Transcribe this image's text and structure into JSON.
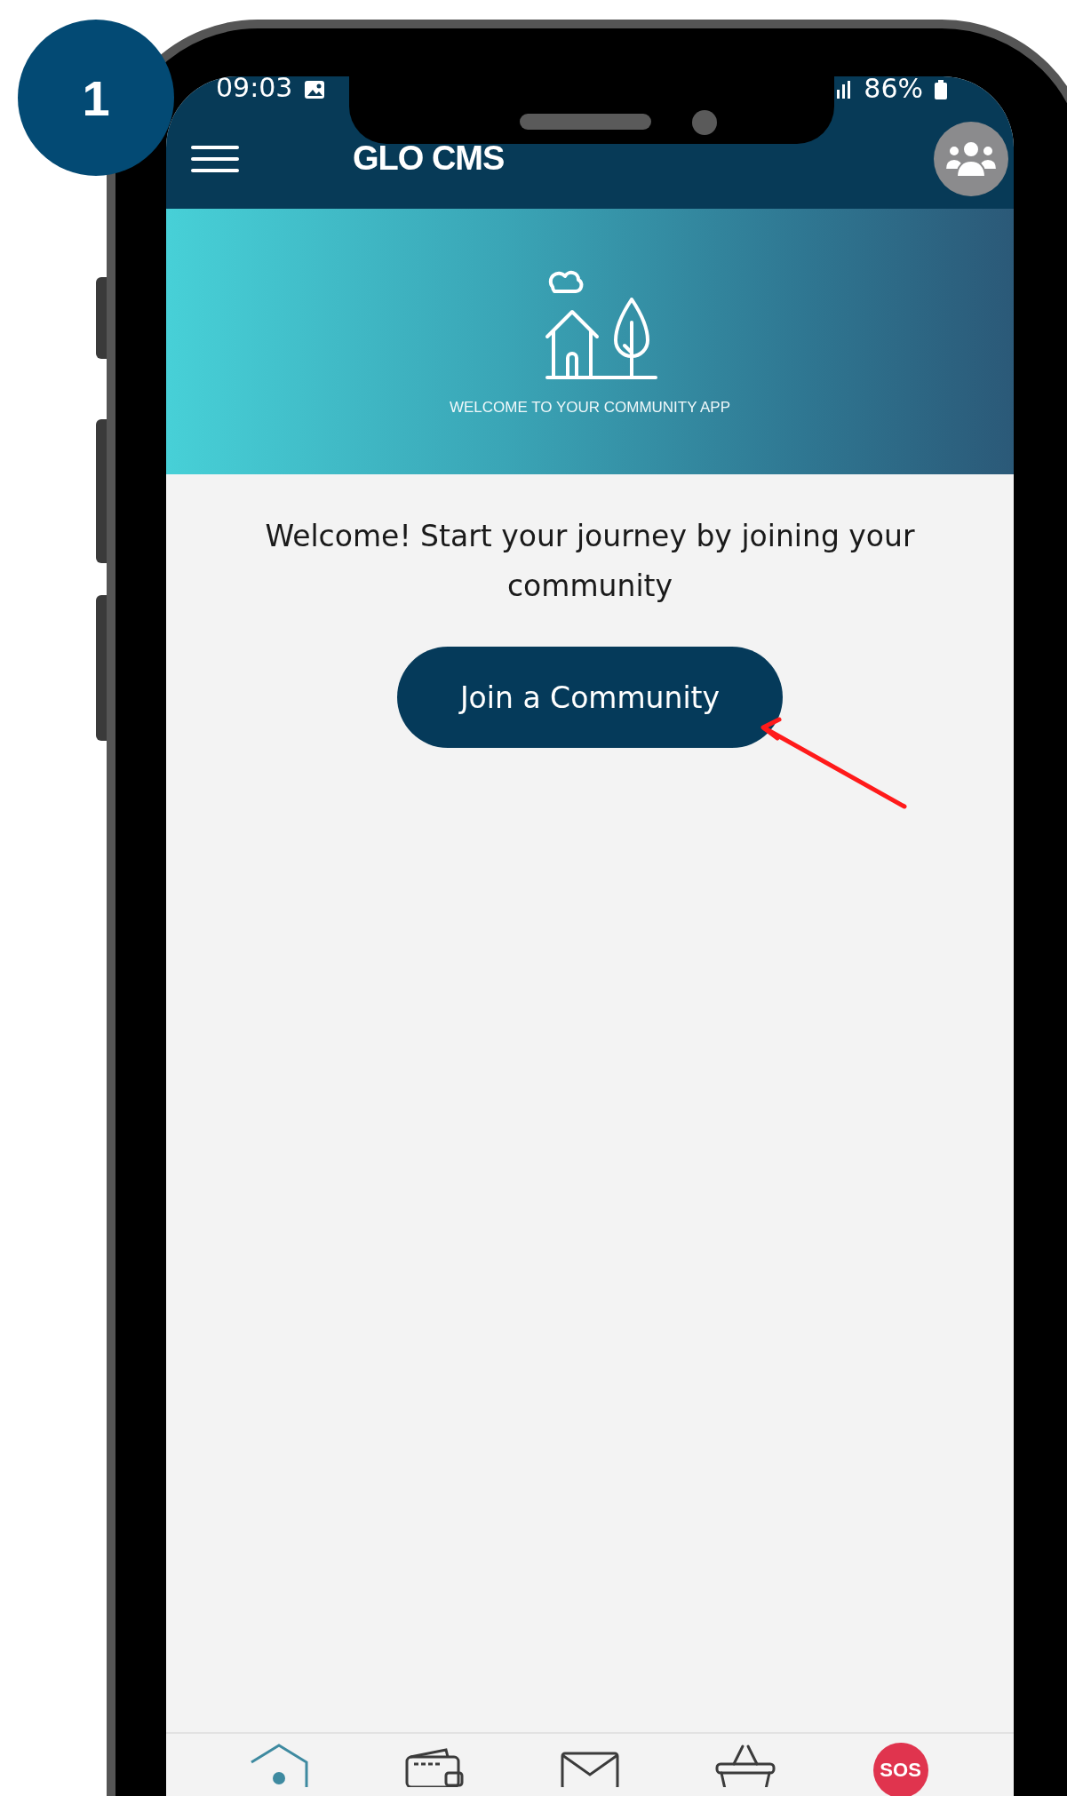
{
  "badge": {
    "number": "1"
  },
  "status_bar": {
    "time": "09:03",
    "battery": "86%"
  },
  "app_bar": {
    "title": "GLO CMS"
  },
  "banner": {
    "caption": "WELCOME TO YOUR COMMUNITY APP"
  },
  "welcome": {
    "message": "Welcome! Start your journey by joining your community",
    "button": "Join a Community"
  },
  "bottom_nav": [
    {
      "kind": "home",
      "selected": true
    },
    {
      "kind": "wallet",
      "selected": false
    },
    {
      "kind": "mail",
      "selected": false
    },
    {
      "kind": "basket",
      "selected": false
    },
    {
      "kind": "sos",
      "label": "SOS",
      "selected": false
    }
  ]
}
